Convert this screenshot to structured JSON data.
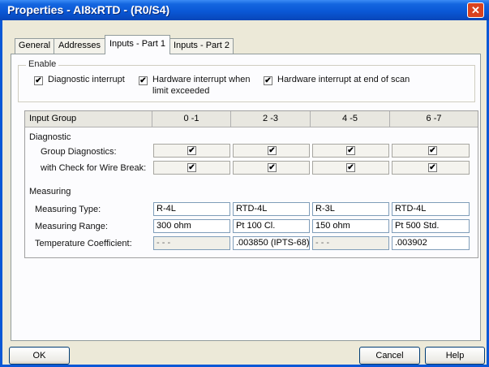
{
  "window": {
    "title": "Properties - AI8xRTD - (R0/S4)",
    "close_glyph": "✕"
  },
  "tabs": [
    {
      "label": "General",
      "active": false
    },
    {
      "label": "Addresses",
      "active": false
    },
    {
      "label": "Inputs - Part 1",
      "active": true
    },
    {
      "label": "Inputs - Part 2",
      "active": false
    }
  ],
  "enable": {
    "legend": "Enable",
    "options": [
      {
        "label": "Diagnostic interrupt",
        "checked": true
      },
      {
        "label": "Hardware interrupt when",
        "label2": "limit exceeded",
        "checked": true
      },
      {
        "label": "Hardware interrupt at end of scan",
        "checked": true
      }
    ]
  },
  "table": {
    "header_label": "Input Group",
    "groups": [
      "0 -1",
      "2 -3",
      "4 -5",
      "6 -7"
    ],
    "diagnostic": {
      "section": "Diagnostic",
      "group_diag_label": "Group Diagnostics:",
      "wire_break_label": "with Check for Wire Break:",
      "group_diag": [
        true,
        true,
        true,
        true
      ],
      "wire_break": [
        true,
        true,
        true,
        true
      ]
    },
    "measuring": {
      "section": "Measuring",
      "type_label": "Measuring Type:",
      "range_label": "Measuring Range:",
      "coef_label": "Temperature Coefficient:",
      "types": [
        "R-4L",
        "RTD-4L",
        "R-3L",
        "RTD-4L"
      ],
      "ranges": [
        "300 ohm",
        "Pt 100 Cl.",
        "150 ohm",
        "Pt 500 Std."
      ],
      "coefficients": [
        "- - -",
        ".003850 (IPTS-68)",
        "- - -",
        ".003902"
      ]
    }
  },
  "buttons": {
    "ok": "OK",
    "cancel": "Cancel",
    "help": "Help"
  },
  "check_glyph": "✔"
}
